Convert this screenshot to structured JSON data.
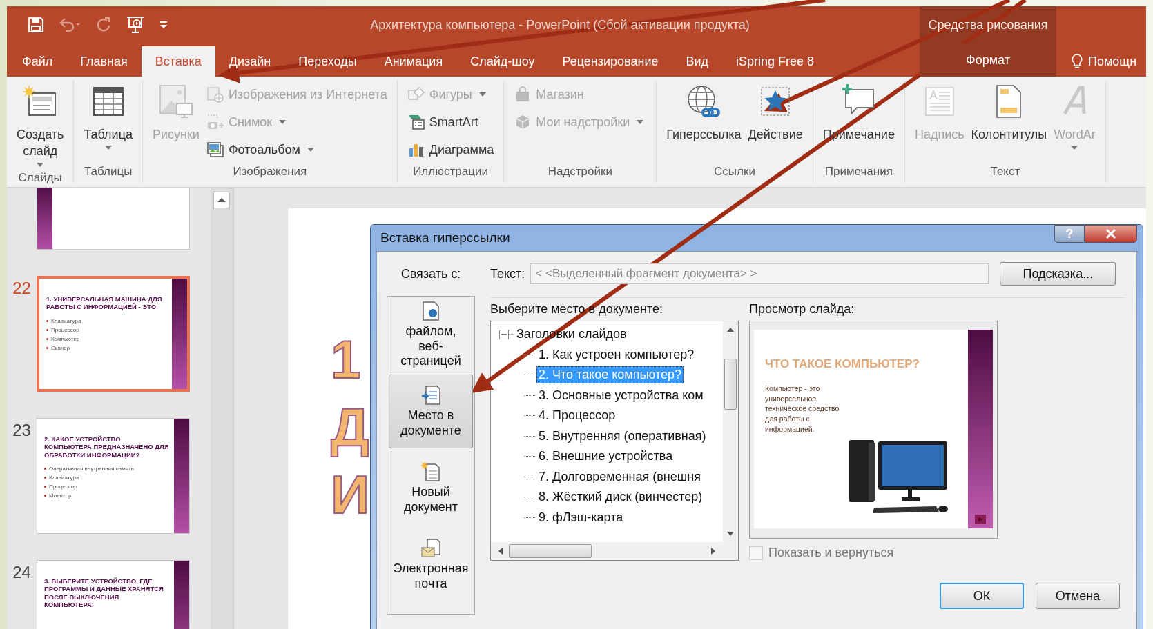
{
  "window": {
    "title": "Архитектура компьютера - PowerPoint (Сбой активации продукта)",
    "context_group": "Средства рисования"
  },
  "quick_access": [
    {
      "kind": "save",
      "disabled": false
    },
    {
      "kind": "undo",
      "disabled": true
    },
    {
      "kind": "redo",
      "disabled": true
    },
    {
      "kind": "present",
      "disabled": false
    },
    {
      "kind": "customize",
      "disabled": false
    }
  ],
  "tabs": [
    {
      "label": "Файл",
      "selected": false,
      "contextual": false
    },
    {
      "label": "Главная",
      "selected": false,
      "contextual": false
    },
    {
      "label": "Вставка",
      "selected": true,
      "contextual": false
    },
    {
      "label": "Дизайн",
      "selected": false,
      "contextual": false
    },
    {
      "label": "Переходы",
      "selected": false,
      "contextual": false
    },
    {
      "label": "Анимация",
      "selected": false,
      "contextual": false
    },
    {
      "label": "Слайд-шоу",
      "selected": false,
      "contextual": false
    },
    {
      "label": "Рецензирование",
      "selected": false,
      "contextual": false
    },
    {
      "label": "Вид",
      "selected": false,
      "contextual": false
    },
    {
      "label": "iSpring Free 8",
      "selected": false,
      "contextual": false
    },
    {
      "label": "Формат",
      "selected": false,
      "contextual": true
    }
  ],
  "tell_me": "Помощн",
  "ribbon": {
    "groups": [
      {
        "label": "Слайды",
        "columns": [
          [
            {
              "kind": "new-slide",
              "label": "Создать слайд",
              "dropdown": true,
              "disabled": false
            }
          ]
        ]
      },
      {
        "label": "Таблицы",
        "columns": [
          [
            {
              "kind": "table",
              "label": "Таблица",
              "dropdown": true,
              "disabled": false
            }
          ]
        ]
      },
      {
        "label": "Изображения",
        "columns": [
          [
            {
              "kind": "picture",
              "label": "Рисунки",
              "dropdown": false,
              "disabled": true
            }
          ],
          [
            {
              "kind": "online-picture",
              "label": "Изображения из Интернета",
              "dropdown": false,
              "disabled": true
            },
            {
              "kind": "screenshot",
              "label": "Снимок",
              "dropdown": true,
              "disabled": true
            },
            {
              "kind": "album",
              "label": "Фотоальбом",
              "dropdown": true,
              "disabled": false
            }
          ]
        ]
      },
      {
        "label": "Иллюстрации",
        "columns": [
          [
            {
              "kind": "shapes",
              "label": "Фигуры",
              "dropdown": true,
              "disabled": true
            },
            {
              "kind": "smartart",
              "label": "SmartArt",
              "dropdown": false,
              "disabled": false
            },
            {
              "kind": "chart",
              "label": "Диаграмма",
              "dropdown": false,
              "disabled": false
            }
          ]
        ]
      },
      {
        "label": "Надстройки",
        "columns": [
          [
            {
              "kind": "store",
              "label": "Магазин",
              "dropdown": false,
              "disabled": true
            },
            {
              "kind": "addins",
              "label": "Мои надстройки",
              "dropdown": true,
              "disabled": true
            }
          ]
        ]
      },
      {
        "label": "Ссылки",
        "columns": [
          [
            {
              "kind": "hyperlink",
              "label": "Гиперссылка",
              "dropdown": false,
              "disabled": false
            }
          ],
          [
            {
              "kind": "action",
              "label": "Действие",
              "dropdown": false,
              "disabled": false
            }
          ]
        ]
      },
      {
        "label": "Примечания",
        "columns": [
          [
            {
              "kind": "comment",
              "label": "Примечание",
              "dropdown": false,
              "disabled": false
            }
          ]
        ]
      },
      {
        "label": "Текст",
        "columns": [
          [
            {
              "kind": "textbox",
              "label": "Надпись",
              "dropdown": false,
              "disabled": true
            }
          ],
          [
            {
              "kind": "header",
              "label": "Колонтитулы",
              "dropdown": false,
              "disabled": false
            }
          ],
          [
            {
              "kind": "wordart",
              "label": "WordAr",
              "dropdown": true,
              "disabled": true
            }
          ]
        ]
      }
    ]
  },
  "thumbnails": [
    {
      "number": "22",
      "title": "1. УНИВЕРСАЛЬНАЯ МАШИНА ДЛЯ РАБОТЫ С ИНФОРМАЦИЕЙ - ЭТО:",
      "bullets": [
        "Клавиатура",
        "Процессор",
        "Компьютер",
        "Сканер"
      ],
      "selected": true
    },
    {
      "number": "23",
      "title": "2. КАКОЕ УСТРОЙСТВО КОМПЬЮТЕРА ПРЕДНАЗНАЧЕНО ДЛЯ ОБРАБОТКИ ИНФОРМАЦИИ?",
      "bullets": [
        "Оперативная внутренняя память",
        "Клавиатура",
        "Процессор",
        "Монитор"
      ],
      "selected": false
    },
    {
      "number": "24",
      "title": "3. ВЫБЕРИТЕ УСТРОЙСТВО, ГДЕ ПРОГРАММЫ И ДАННЫЕ ХРАНЯТСЯ ПОСЛЕ ВЫКЛЮЧЕНИЯ КОМПЬЮТЕРА:",
      "selected": false
    }
  ],
  "slide_letters": [
    "1",
    "Д",
    "И"
  ],
  "dialog": {
    "title": "Вставка гиперссылки",
    "help": "?",
    "link_to_label": "Связать с:",
    "link_to": [
      {
        "kind": "file",
        "label": "файлом, веб-страницей",
        "selected": false
      },
      {
        "kind": "place",
        "label": "Место в документе",
        "selected": true
      },
      {
        "kind": "new",
        "label": "Новый документ",
        "selected": false
      },
      {
        "kind": "email",
        "label": "Электронная почта",
        "selected": false
      }
    ],
    "text_label": "Текст:",
    "text_value": "< <Выделенный фрагмент документа> >",
    "hint_button": "Подсказка...",
    "place_label": "Выберите место в документе:",
    "tree": [
      {
        "label": "Заголовки слайдов",
        "expanded": true,
        "selected": false,
        "children": [
          {
            "label": "1. Как устроен компьютер?",
            "selected": false
          },
          {
            "label": "2. Что такое компьютер?",
            "selected": true
          },
          {
            "label": "3. Основные устройства ком",
            "selected": false
          },
          {
            "label": "4. Процессор",
            "selected": false
          },
          {
            "label": "5. Внутренняя (оперативная)",
            "selected": false
          },
          {
            "label": "6. Внешние устройства",
            "selected": false
          },
          {
            "label": "7. Долговременная (внешня",
            "selected": false
          },
          {
            "label": "8. Жёсткий диск (винчестер)",
            "selected": false
          },
          {
            "label": "9. фЛэш-карта",
            "selected": false
          }
        ]
      }
    ],
    "preview_label": "Просмотр слайда:",
    "preview": {
      "title": "ЧТО ТАКОЕ КОМПЬЮТЕР?",
      "text": "Компьютер - это универсальное техническое средство для работы с информацией."
    },
    "show_and_return": {
      "label": "Показать и вернуться",
      "checked": false,
      "disabled": true
    },
    "buttons": [
      {
        "label": "ОК",
        "default": true
      },
      {
        "label": "Отмена",
        "default": false
      }
    ]
  }
}
